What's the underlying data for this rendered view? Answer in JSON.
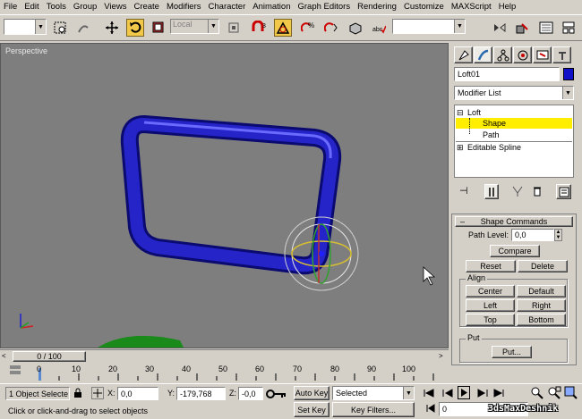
{
  "menu": [
    "File",
    "Edit",
    "Tools",
    "Group",
    "Views",
    "Create",
    "Modifiers",
    "Character",
    "Animation",
    "Graph Editors",
    "Rendering",
    "Customize",
    "MAXScript",
    "Help"
  ],
  "toolbar": {
    "coord_system": "Local",
    "named_selection": ""
  },
  "viewport": {
    "label": "Perspective",
    "bg_color": "#7e7e7e",
    "object_color": "#1a1ab0"
  },
  "command_panel": {
    "object_name": "Loft01",
    "object_color": "#1010c8",
    "modifier_list": "Modifier List",
    "stack": [
      {
        "label": "Loft",
        "prefix": "⊟"
      },
      {
        "label": "Shape",
        "selected": true
      },
      {
        "label": "Path"
      },
      {
        "label": "Editable Spline",
        "prefix": "⊞"
      }
    ],
    "rollout_title": "Shape Commands",
    "path_level_label": "Path Level:",
    "path_level_value": "0,0",
    "compare": "Compare",
    "reset": "Reset",
    "delete": "Delete",
    "align_label": "Align",
    "center": "Center",
    "default": "Default",
    "left": "Left",
    "right": "Right",
    "top": "Top",
    "bottom": "Bottom",
    "put_label": "Put",
    "put_button": "Put..."
  },
  "timeline": {
    "frame_display": "0 / 100",
    "ticks": [
      "0",
      "10",
      "20",
      "30",
      "40",
      "50",
      "60",
      "70",
      "80",
      "90",
      "100"
    ]
  },
  "status": {
    "selection": "1 Object Selecte",
    "prompt": "Click or click-and-drag to select objects",
    "x_label": "X:",
    "x_value": "0,0",
    "y_label": "Y:",
    "y_value": "-179,768",
    "z_label": "Z:",
    "z_value": "-0,0",
    "auto_key": "Auto Key",
    "set_key": "Set Key",
    "key_mode": "Selected",
    "key_filters": "Key Filters...",
    "frame": "0"
  },
  "watermark": "3dsMaxDeshnik"
}
